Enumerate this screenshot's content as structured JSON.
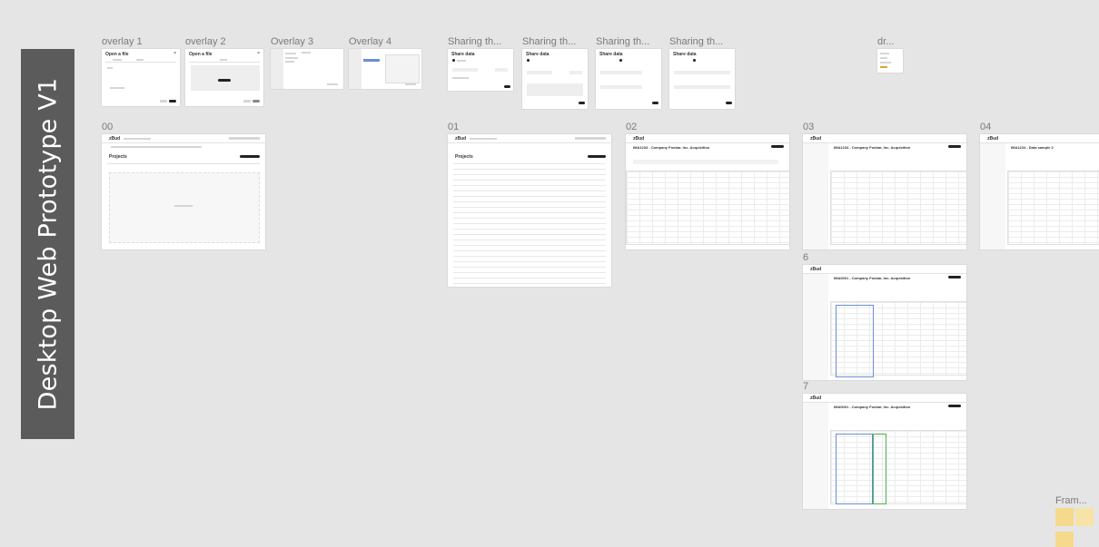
{
  "banner_title": "Desktop Web Prototype V1",
  "frame_labels": {
    "overlay1": "overlay 1",
    "overlay2": "overlay 2",
    "overlay3": "Overlay 3",
    "overlay4": "Overlay 4",
    "sharing1": "Sharing th...",
    "sharing2": "Sharing th...",
    "sharing3": "Sharing th...",
    "sharing4": "Sharing th...",
    "dr": "dr...",
    "f00": "00",
    "f01": "01",
    "f02": "02",
    "f03": "03",
    "f04": "04",
    "f6": "6",
    "f7": "7",
    "fram": "Fram..."
  },
  "frames": {
    "overlay1": {
      "title": "Open a file"
    },
    "overlay2": {
      "title": "Open a file"
    },
    "sharing1": {
      "title": "Share data"
    },
    "sharing2": {
      "title": "Share data"
    },
    "sharing3": {
      "title": "Share data"
    },
    "sharing4": {
      "title": "Share data"
    },
    "f00": {
      "app": "zBud",
      "section": "Projects"
    },
    "f01": {
      "app": "zBud",
      "section": "Projects"
    },
    "f02": {
      "app": "zBud",
      "doc_title": "IMA1234 - Company Foobar, Inc. Acquisition"
    },
    "f03": {
      "app": "zBud",
      "doc_title": "IMA1234 - Company Foobar, Inc. Acquisition"
    },
    "f04": {
      "app": "zBud",
      "doc_title": "IMA1234 - Data sample 2"
    },
    "f6": {
      "app": "zBud",
      "doc_title": "IMA0001 - Company Foobar, Inc. Acquisition"
    },
    "f7": {
      "app": "zBud",
      "doc_title": "IMA0001 - Company Foobar, Inc. Acquisition"
    }
  },
  "colors": {
    "canvas": "#e5e5e5",
    "banner": "#5b5b5b",
    "sticky": "#f5d98c",
    "selection_blue": "#6a8fd8",
    "selection_green": "#4caf50"
  }
}
